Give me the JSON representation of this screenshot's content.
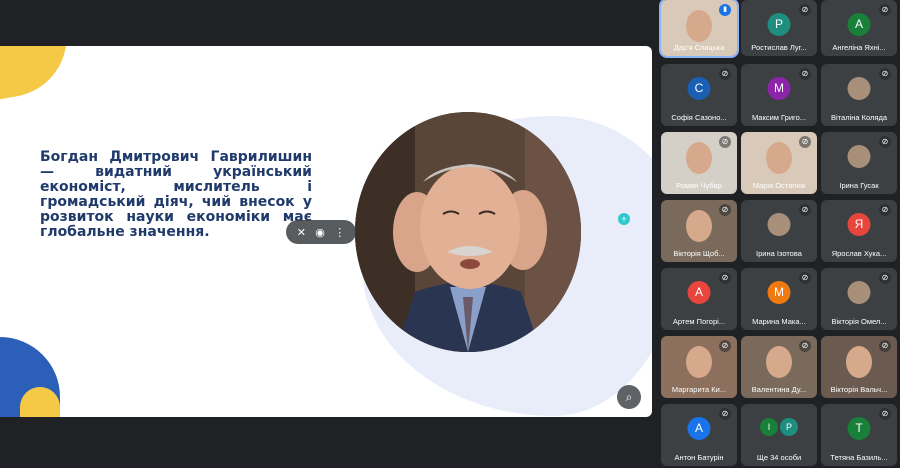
{
  "slide": {
    "text": "Богдан Дмитрович Гаврилишин — видатний український економіст, мислитель і громадський діяч, чий внесок у розвиток науки економіки має глобальне значення."
  },
  "participants": [
    {
      "name": "Дар'я Спицька",
      "type": "video",
      "speaking": true
    },
    {
      "name": "Ростислав Луг...",
      "initial": "Р",
      "color": "#1e8e7e"
    },
    {
      "name": "Ангеліна Яхні...",
      "initial": "А",
      "color": "#188038"
    },
    {
      "name": "Софія Сазоно...",
      "initial": "С",
      "color": "#1a5fb4"
    },
    {
      "name": "Максим Григо...",
      "initial": "М",
      "color": "#8e24aa"
    },
    {
      "name": "Віталіна Коляда",
      "type": "photo"
    },
    {
      "name": "Роман Чубар",
      "type": "video"
    },
    {
      "name": "Марія Остапюк",
      "type": "video"
    },
    {
      "name": "Ірина Гусак",
      "type": "photo"
    },
    {
      "name": "Вікторія Щоб...",
      "type": "video"
    },
    {
      "name": "Ірина Ізотова",
      "type": "photo"
    },
    {
      "name": "Ярослав Хука...",
      "initial": "Я",
      "color": "#e8453c"
    },
    {
      "name": "Артем Погорі...",
      "initial": "А",
      "color": "#e8453c"
    },
    {
      "name": "Марина Мака...",
      "initial": "М",
      "color": "#f07a12"
    },
    {
      "name": "Вікторія Омел...",
      "type": "photo"
    },
    {
      "name": "Маргарита Ки...",
      "type": "video"
    },
    {
      "name": "Валентина Ду...",
      "type": "video"
    },
    {
      "name": "Вікторія Вальч...",
      "type": "video"
    },
    {
      "name": "Антон Батурін",
      "initial": "А",
      "color": "#1a73e8"
    },
    {
      "name": "Ще 34 особи",
      "type": "more",
      "initials": [
        "І",
        "Р"
      ]
    },
    {
      "name": "Тетяна Базиль...",
      "initial": "Т",
      "color": "#188038"
    }
  ],
  "icons": {
    "mute": "mic-off-icon",
    "speaking": "speaking-icon",
    "zoom": "zoom-icon",
    "pin": "pin-icon"
  }
}
